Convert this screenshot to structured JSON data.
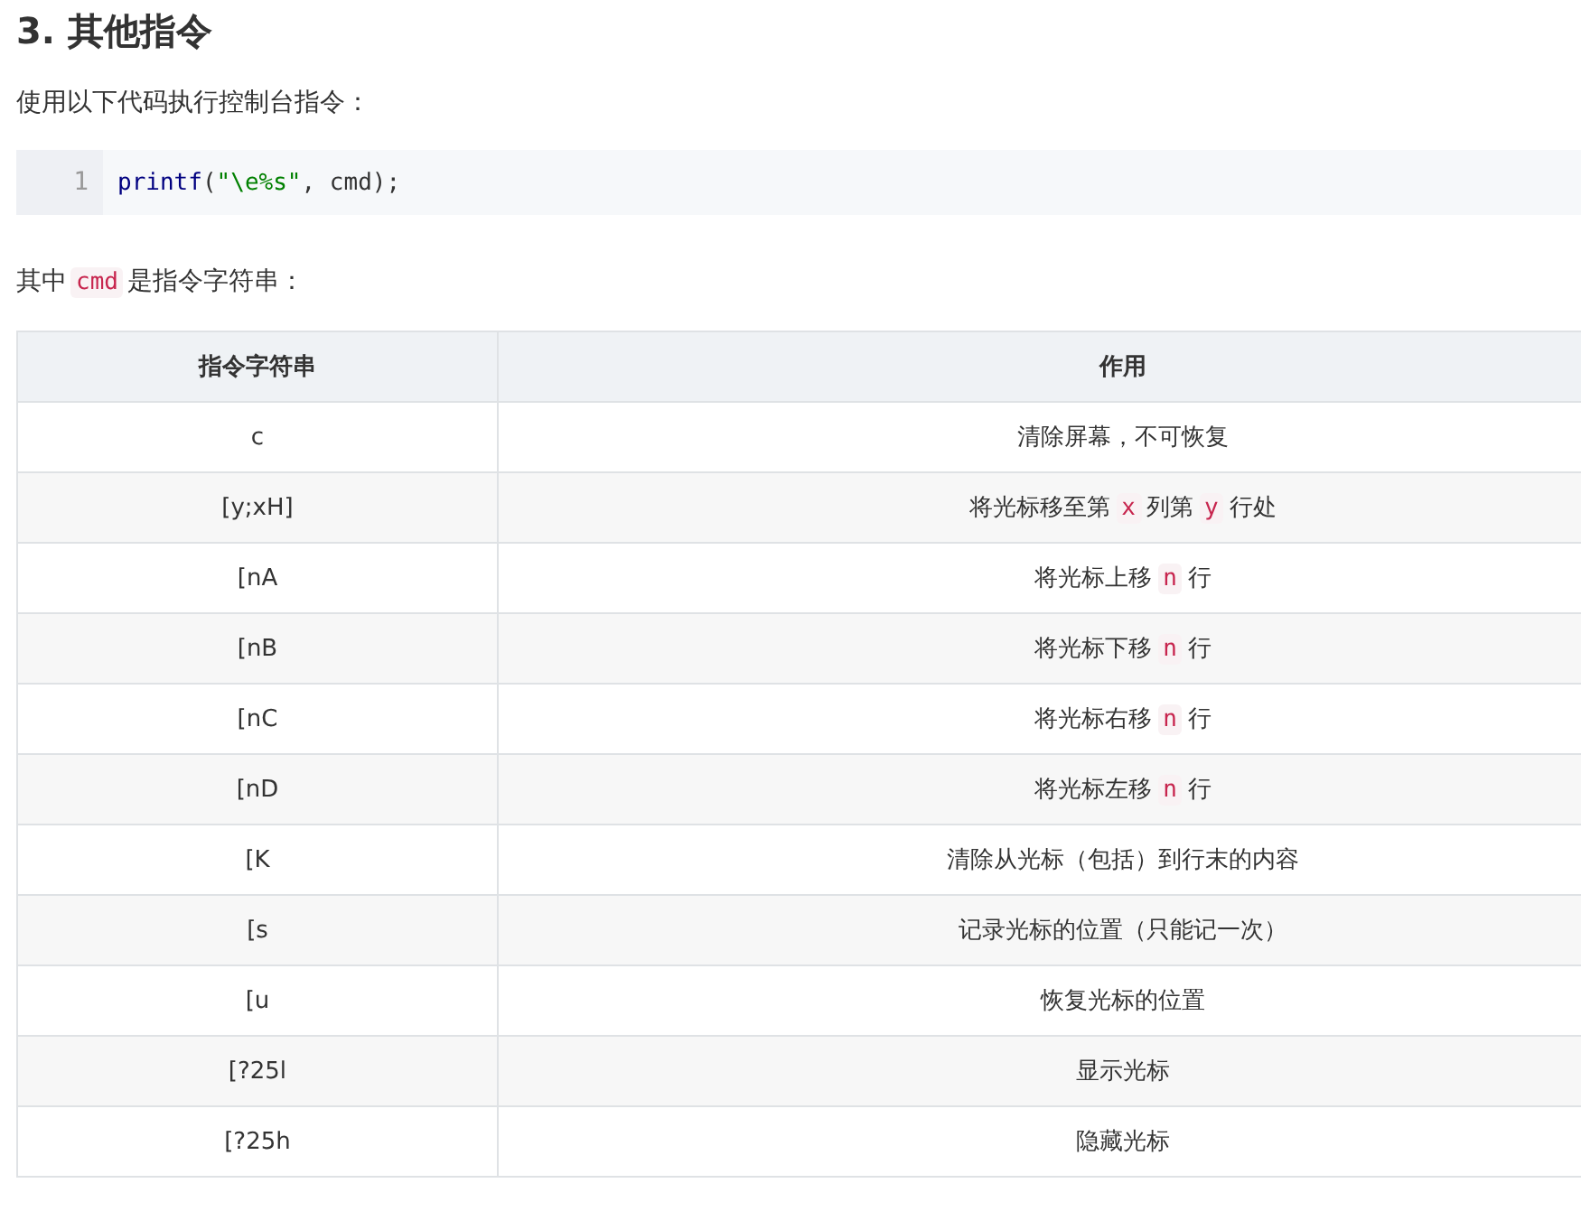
{
  "heading": "3. 其他指令",
  "intro": "使用以下代码执行控制台指令：",
  "code_block": {
    "line_number": "1",
    "tokens": [
      {
        "kind": "func",
        "text": "printf"
      },
      {
        "kind": "plain",
        "text": "("
      },
      {
        "kind": "string",
        "text": "\"\\e%s\""
      },
      {
        "kind": "plain",
        "text": ", cmd);"
      }
    ]
  },
  "note": [
    {
      "kind": "text",
      "text": "其中"
    },
    {
      "kind": "code",
      "text": "cmd"
    },
    {
      "kind": "text",
      "text": "是指令字符串："
    }
  ],
  "table": {
    "columns": [
      "指令字符串",
      "作用"
    ],
    "rows": [
      {
        "command": "c",
        "effect": [
          {
            "kind": "text",
            "text": "清除屏幕，不可恢复"
          }
        ]
      },
      {
        "command": "[y;xH]",
        "effect": [
          {
            "kind": "text",
            "text": "将光标移至第"
          },
          {
            "kind": "code",
            "text": "x"
          },
          {
            "kind": "text",
            "text": "列第"
          },
          {
            "kind": "code",
            "text": "y"
          },
          {
            "kind": "text",
            "text": "行处"
          }
        ]
      },
      {
        "command": "[nA",
        "effect": [
          {
            "kind": "text",
            "text": "将光标上移"
          },
          {
            "kind": "code",
            "text": "n"
          },
          {
            "kind": "text",
            "text": "行"
          }
        ]
      },
      {
        "command": "[nB",
        "effect": [
          {
            "kind": "text",
            "text": "将光标下移"
          },
          {
            "kind": "code",
            "text": "n"
          },
          {
            "kind": "text",
            "text": "行"
          }
        ]
      },
      {
        "command": "[nC",
        "effect": [
          {
            "kind": "text",
            "text": "将光标右移"
          },
          {
            "kind": "code",
            "text": "n"
          },
          {
            "kind": "text",
            "text": "行"
          }
        ]
      },
      {
        "command": "[nD",
        "effect": [
          {
            "kind": "text",
            "text": "将光标左移"
          },
          {
            "kind": "code",
            "text": "n"
          },
          {
            "kind": "text",
            "text": "行"
          }
        ]
      },
      {
        "command": "[K",
        "effect": [
          {
            "kind": "text",
            "text": "清除从光标（包括）到行末的内容"
          }
        ]
      },
      {
        "command": "[s",
        "effect": [
          {
            "kind": "text",
            "text": "记录光标的位置（只能记一次）"
          }
        ]
      },
      {
        "command": "[u",
        "effect": [
          {
            "kind": "text",
            "text": "恢复光标的位置"
          }
        ]
      },
      {
        "command": "[?25l",
        "effect": [
          {
            "kind": "text",
            "text": "显示光标"
          }
        ]
      },
      {
        "command": "[?25h",
        "effect": [
          {
            "kind": "text",
            "text": "隐藏光标"
          }
        ]
      }
    ]
  }
}
